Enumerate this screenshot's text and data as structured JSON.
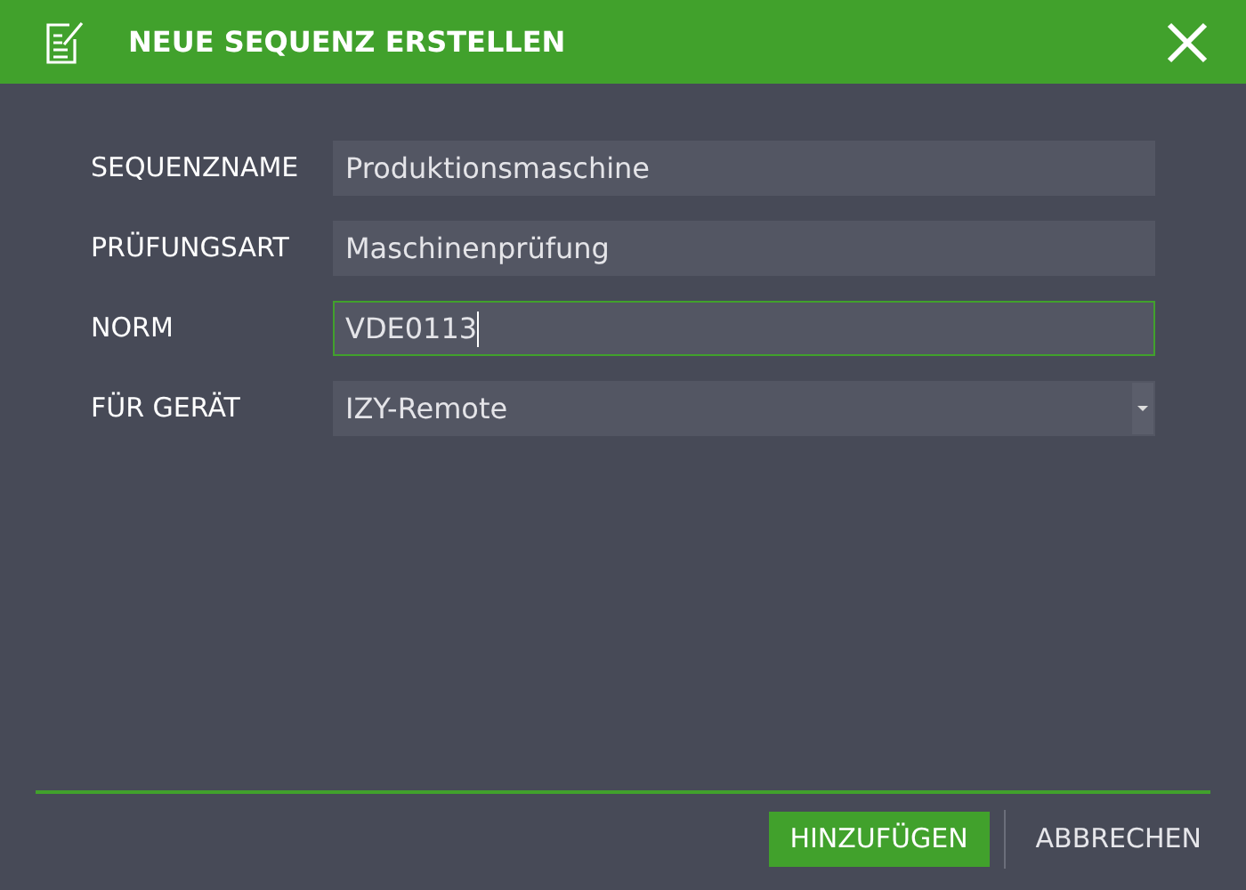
{
  "window": {
    "title": "NEUE SEQUENZ ERSTELLEN"
  },
  "fields": [
    {
      "label": "SEQUENZNAME",
      "kind": "text",
      "value": "Produktionsmaschine",
      "focused": false
    },
    {
      "label": "PRÜFUNGSART",
      "kind": "text",
      "value": "Maschinenprüfung",
      "focused": false
    },
    {
      "label": "NORM",
      "kind": "text",
      "value": "VDE0113",
      "focused": true
    },
    {
      "label": "FÜR GERÄT",
      "kind": "select",
      "value": "IZY-Remote",
      "focused": false
    }
  ],
  "buttons": [
    {
      "label": "HINZUFÜGEN",
      "kind": "primary"
    },
    {
      "label": "ABBRECHEN",
      "kind": "secondary"
    }
  ]
}
